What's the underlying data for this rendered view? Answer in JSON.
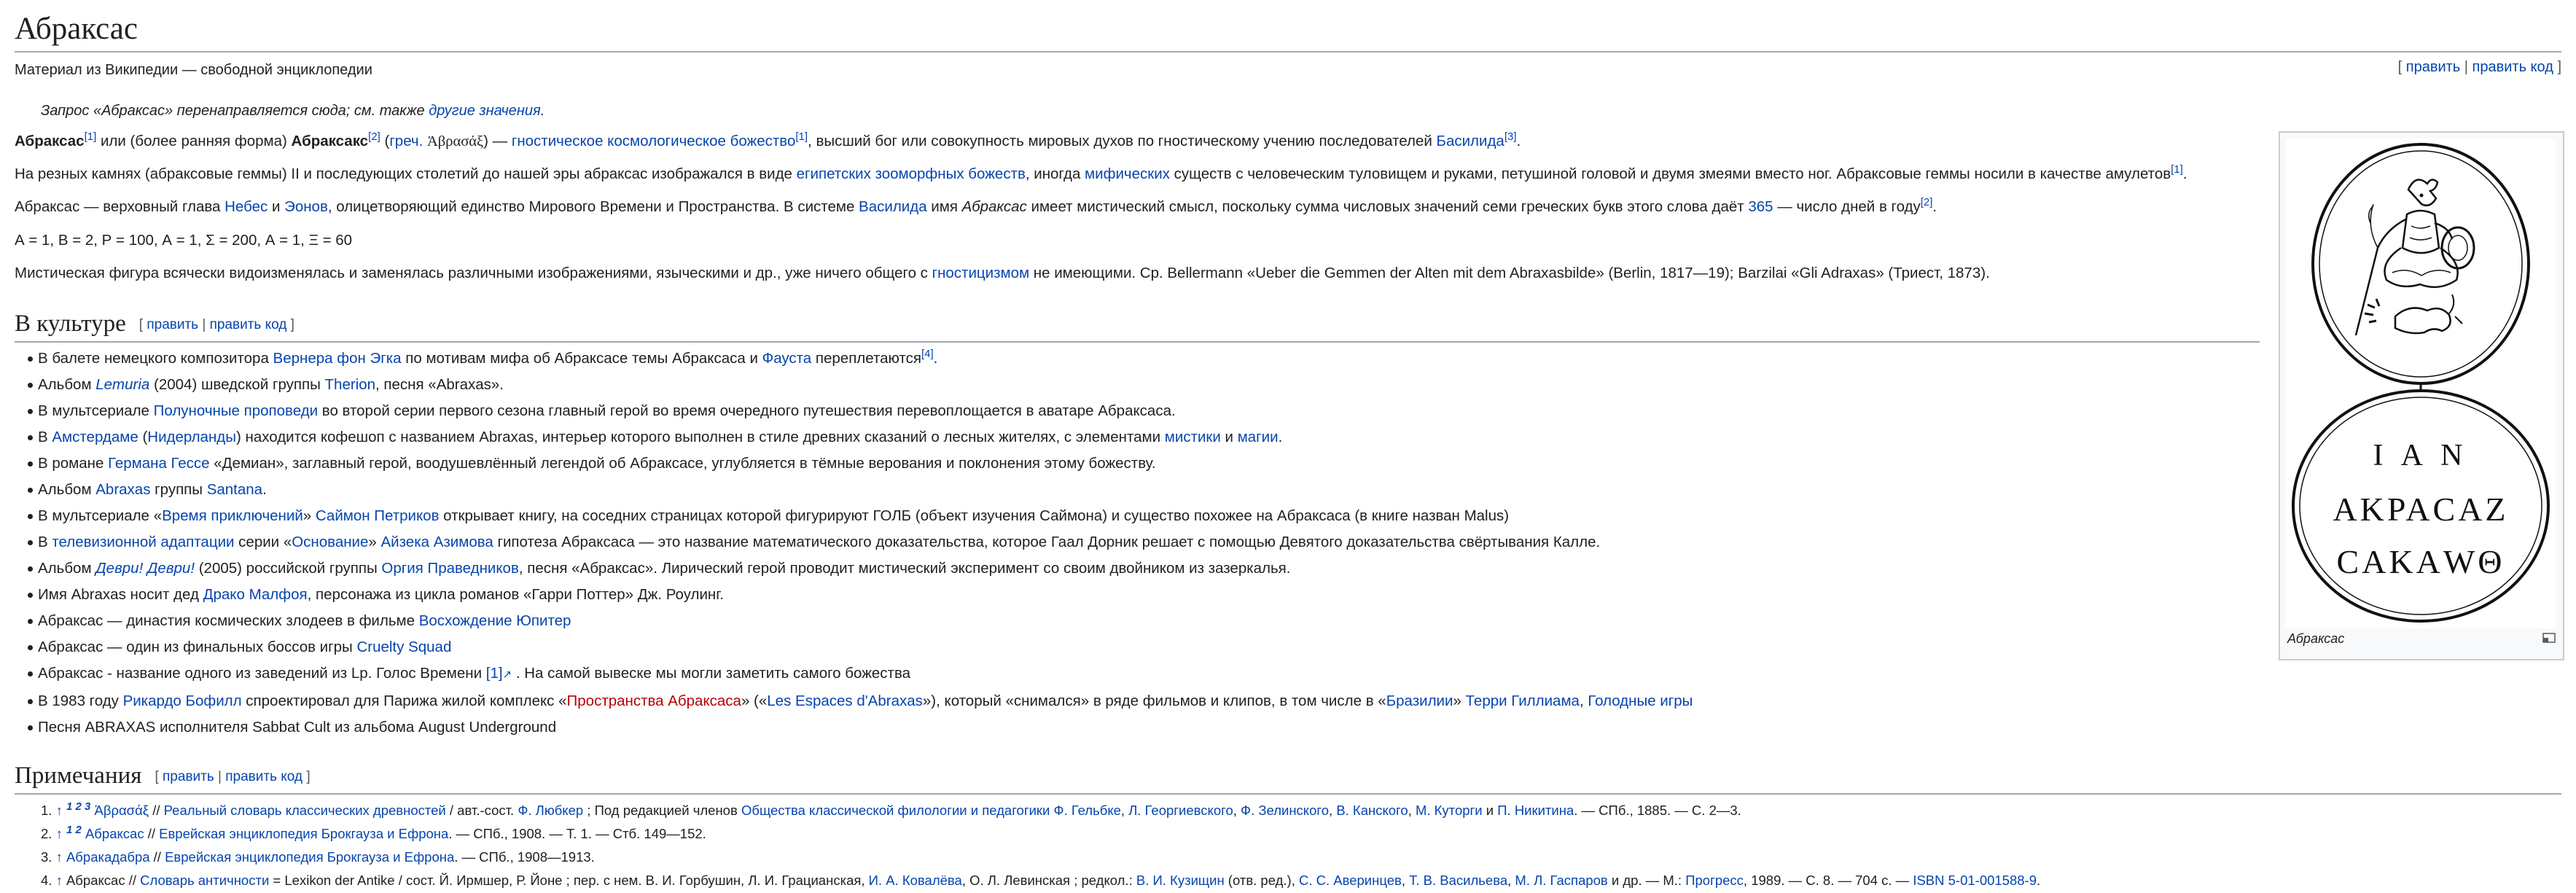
{
  "title": "Абраксас",
  "tagline": "Материал из Википедии — свободной энциклопедии",
  "edit": {
    "open": "[",
    "sep": "|",
    "close": "]",
    "edit": "править",
    "edit_code": "править код"
  },
  "hatnote": {
    "text": "Запрос «Абраксас» перенаправляется сюда; см. также",
    "link": "другие значения",
    "end": "."
  },
  "lead": {
    "p1": {
      "b1": "Абраксас",
      "r1": "[1]",
      "t1": " или (более ранняя форма) ",
      "b2": "Абраксакс",
      "r2": "[2]",
      "t2": " (",
      "greek_link": "греч.",
      "greek": "Ἀβρασάξ",
      "t3": ") — ",
      "l1": "гностическое космологическое божество",
      "r3": "[1]",
      "t4": ", высший бог или совокупность мировых духов по гностическому учению последователей ",
      "l2": "Басилида",
      "r4": "[3]",
      "t5": "."
    },
    "p2": {
      "t1": "На резных камнях (абраксовые геммы) II и последующих столетий до нашей эры абраксас изображался в виде ",
      "l1": "египетских зооморфных божеств",
      "t2": ", иногда ",
      "l2": "мифических",
      "t3": " существ с человеческим туловищем и руками, петушиной головой и двумя змеями вместо ног. Абраксовые геммы носили в качестве амулетов",
      "r1": "[1]",
      "t4": "."
    },
    "p3": {
      "t1": "Абраксас — верховный глава ",
      "l1": "Небес",
      "t2": " и ",
      "l2": "Эонов",
      "t3": ", олицетворяющий единство Мирового Времени и Пространства. В системе ",
      "l3": "Василида",
      "t4": " имя ",
      "i1": "Абраксас",
      "t5": " имеет мистический смысл, поскольку сумма числовых значений семи греческих букв этого слова даёт ",
      "l4": "365",
      "t6": " — число дней в году",
      "r1": "[2]",
      "t7": "."
    },
    "p4": "А = 1, В = 2, Р = 100, А = 1, Σ = 200, А = 1, Ξ = 60",
    "p5": {
      "t1": "Мистическая фигура всячески видоизменялась и заменялась различными изображениями, языческими и др., уже ничего общего с ",
      "l1": "гностицизмом",
      "t2": " не имеющими. Ср. Bellermann «Ueber die Gemmen der Alten mit dem Abraxasbilde» (Berlin, 1817—19); Barzilai «Gli Adraxas» (Триест, 1873)."
    }
  },
  "culture": {
    "heading": "В культуре",
    "items": [
      {
        "t1": "В балете немецкого композитора ",
        "l1": "Вернера фон Эгка",
        "t2": " по мотивам мифа об Абраксасе темы Абраксаса и ",
        "l2": "Фауста",
        "t3": " переплетаются",
        "r1": "[4]",
        "t4": "."
      },
      {
        "t1": "Альбом ",
        "l1": "Lemuria",
        "t2": " (2004) шведской группы ",
        "l2": "Therion",
        "t3": ", песня «Abraxas»."
      },
      {
        "t1": "В мультсериале ",
        "l1": "Полуночные проповеди",
        "t2": " во второй серии первого сезона главный герой во время очередного путешествия перевоплощается в аватаре Абраксаса."
      },
      {
        "t1": "В ",
        "l1": "Амстердаме",
        "t2": " (",
        "l2": "Нидерланды",
        "t3": ") находится кофешоп с названием Abraxas, интерьер которого выполнен в стиле древних сказаний о лесных жителях, с элементами ",
        "l3": "мистики",
        "t4": " и ",
        "l4": "магии",
        "t5": "."
      },
      {
        "t1": "В романе ",
        "l1": "Германа Гессе",
        "t2": " «Демиан», заглавный герой, воодушевлённый легендой об Абраксасе, углубляется в тёмные верования и поклонения этому божеству."
      },
      {
        "t1": "Альбом ",
        "l1": "Abraxas",
        "t2": " группы ",
        "l2": "Santana",
        "t3": "."
      },
      {
        "t1": "В мультсериале «",
        "l1": "Время приключений",
        "t2": "» ",
        "l2": "Саймон Петриков",
        "t3": " открывает книгу, на соседних страницах которой фигурируют ГОЛБ (объект изучения Саймона) и существо похожее на Абраксаса (в книге назван Malus)"
      },
      {
        "t1": "В ",
        "l1": "телевизионной адаптации",
        "t2": " серии «",
        "l2": "Основание",
        "t3": "» ",
        "l3": "Айзека Азимова",
        "t4": " гипотеза Абраксаса — это название математического доказательства, которое Гаал Дорник решает с помощью Девятого доказательства свёртывания Калле."
      },
      {
        "t1": "Альбом ",
        "l1": "Деври! Деври!",
        "t2": " (2005) российской группы ",
        "l2": "Оргия Праведников",
        "t3": ", песня «Абраксас». Лирический герой проводит мистический эксперимент со своим двойником из зазеркалья."
      },
      {
        "t1": "Имя Abraxas носит дед ",
        "l1": "Драко Малфоя",
        "t2": ", персонажа из цикла романов «Гарри Поттер» Дж. Роулинг."
      },
      {
        "t1": "Абраксас — династия космических злодеев в фильме ",
        "l1": "Восхождение Юпитер"
      },
      {
        "t1": "Абраксас — один из финальных боссов игры ",
        "l1": "Cruelty Squad"
      },
      {
        "t1": "Абраксас - название одного из заведений из Lp. Голос Времени ",
        "l1": "[1]",
        "t2": " . На самой вывеске мы могли заметить самого божества"
      },
      {
        "t1": "В 1983 году ",
        "l1": "Рикардо Бофилл",
        "t2": " спроектировал для Парижа жилой комплекс «",
        "l2": "Пространства Абраксаса",
        "t3": "» («",
        "l3": "Les Espaces d'Abraxas",
        "t4": "»), который «снимался» в ряде фильмов и клипов, в том числе в «",
        "l4": "Бразилии",
        "t5": "» ",
        "l5": "Терри Гиллиама",
        "t6": ", ",
        "l6": "Голодные игры"
      },
      {
        "t1": "Песня ABRAXAS исполнителя Sabbat Cult из альбома August Underground"
      }
    ]
  },
  "notes": {
    "heading": "Примечания",
    "items": [
      {
        "num": "1.",
        "back": "↑",
        "refs": "1 2 3",
        "l1": "Ἀβρασάξ",
        "t1": " // ",
        "l2": "Реальный словарь классических древностей",
        "t2": " / авт.-сост. ",
        "l3": "Ф. Любкер",
        "t3": " ; Под редакцией членов ",
        "l4": "Общества классической филологии и педагогики",
        "t4": " ",
        "l5": "Ф. Гельбке",
        "t5": ", ",
        "l6": "Л. Георгиевского",
        "t6": ", ",
        "l7": "Ф. Зелинского",
        "t7": ", ",
        "l8": "В. Канского",
        "t8": ", ",
        "l9": "М. Куторги",
        "t9": " и ",
        "l10": "П. Никитина",
        "t10": ". — СПб., 1885. — С. 2—3."
      },
      {
        "num": "2.",
        "back": "↑",
        "refs": "1 2",
        "l1": "Абраксас",
        "t1": " // ",
        "l2": "Еврейская энциклопедия Брокгауза и Ефрона",
        "t2": ". — СПб., 1908. — Т. 1. — Стб. 149—152."
      },
      {
        "num": "3.",
        "back": "↑",
        "l1": "Абракадабра",
        "t1": " // ",
        "l2": "Еврейская энциклопедия Брокгауза и Ефрона",
        "t2": ". — СПб., 1908—1913."
      },
      {
        "num": "4.",
        "back": "↑",
        "t0": " Абраксас // ",
        "l1": "Словарь античности",
        "t1": " = Lexikon der Antike / сост. Й. Ирмшер, Р. Йоне ; пер. с нем. В. И. Горбушин, Л. И. Грацианская, ",
        "l2": "И. А. Ковалёва",
        "t2": ", О. Л. Левинская ; редкол.: ",
        "l3": "В. И. Кузищин",
        "t3": " (отв. ред.), ",
        "l4": "С. С. Аверинцев",
        "t4": ", ",
        "l5": "Т. В. Васильева",
        "t5": ", ",
        "l6": "М. Л. Гаспаров",
        "t6": " и др. — М.: ",
        "l7": "Прогресс",
        "t7": ", 1989. — С. 8. — 704 с. — ",
        "l8": "ISBN 5-01-001588-9",
        "t8": "."
      }
    ]
  },
  "infobox": {
    "caption": "Абраксас",
    "gem_text": {
      "line1": "I A N",
      "line2": "ΑΚΡΑCΑΖ",
      "line3": "CΑΚΑWΘ"
    },
    "magnify_icon": "magnify-icon"
  }
}
